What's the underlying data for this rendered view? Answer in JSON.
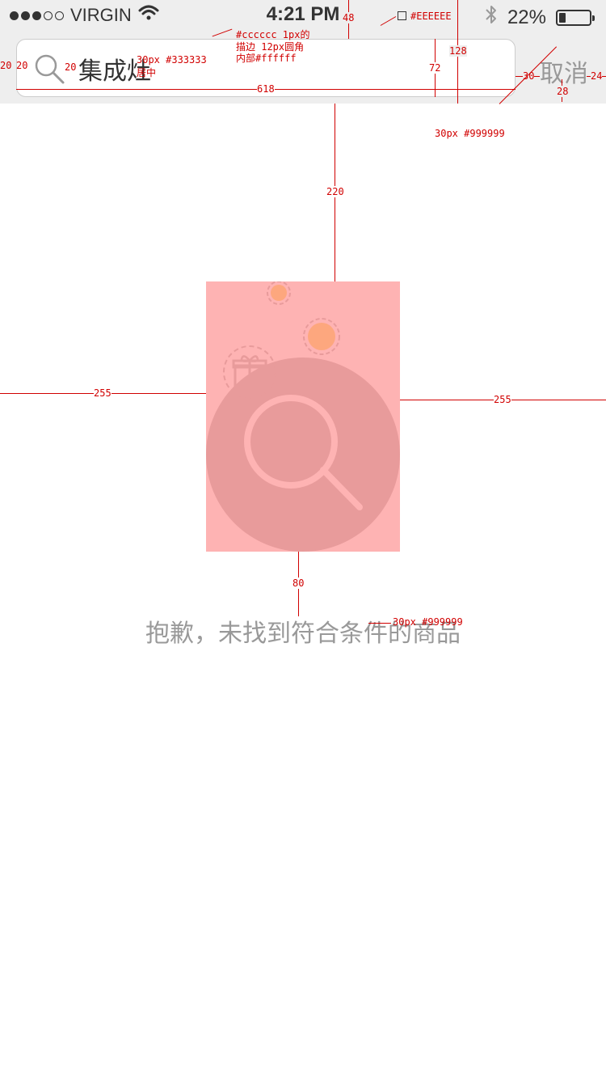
{
  "status_bar": {
    "carrier": "VIRGIN",
    "signal_dots_filled": 3,
    "signal_dots_total": 5,
    "time": "4:21 PM",
    "battery_percent": "22%",
    "battery_level": 0.22,
    "icons": [
      "wifi-icon",
      "bluetooth-icon",
      "battery-icon"
    ]
  },
  "search": {
    "icon": "search-icon",
    "query": "集成灶",
    "cancel_label": "取消"
  },
  "empty_state": {
    "illustration_icons": [
      "search-icon",
      "gift-icon"
    ],
    "message": "抱歉，未找到符合条件的商品"
  },
  "annotations": {
    "header_bg": "#EEEEEE",
    "status_height": "48",
    "header_height": "128",
    "box_height": "72",
    "box_width": "618",
    "box_note_1": "#cccccc  1px的",
    "box_note_2": "描边 12px圆角",
    "box_note_3": "内部#ffffff",
    "query_font": "30px  #333333",
    "query_align": "居中",
    "left_pad": "20",
    "icon_pad": "20",
    "text_gap": "20",
    "cancel_gap": "30",
    "cancel_right": "24",
    "cancel_size": "28",
    "cancel_font": "30px  #999999",
    "top_gap": "220",
    "side_left": "255",
    "side_right": "255",
    "bottom_gap": "80",
    "msg_font": "30px  #999999"
  },
  "colors": {
    "header_bg": "#EEEEEE",
    "box_border": "#cccccc",
    "box_fill": "#ffffff",
    "query_text": "#333333",
    "cancel_text": "#999999",
    "illustration_bg": "#FEB3B3",
    "circle": "#E89B9B",
    "orange": "#FDA77E"
  }
}
